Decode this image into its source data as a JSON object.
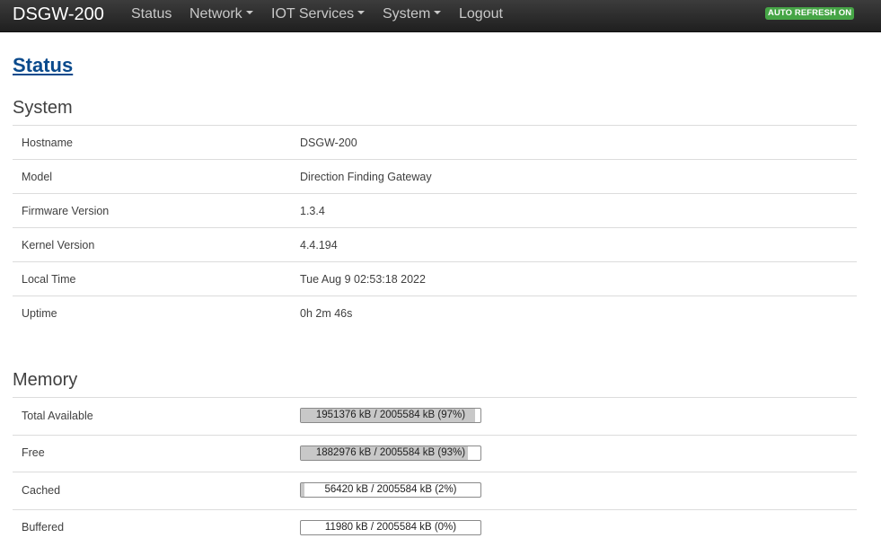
{
  "header": {
    "brand": "DSGW-200",
    "menu": [
      {
        "label": "Status",
        "dropdown": false
      },
      {
        "label": "Network",
        "dropdown": true
      },
      {
        "label": "IOT Services",
        "dropdown": true
      },
      {
        "label": "System",
        "dropdown": true
      },
      {
        "label": "Logout",
        "dropdown": false
      }
    ],
    "auto_refresh": "AUTO REFRESH ON"
  },
  "page_title": "Status",
  "system": {
    "title": "System",
    "rows": [
      {
        "key": "Hostname",
        "value": "DSGW-200"
      },
      {
        "key": "Model",
        "value": "Direction Finding Gateway"
      },
      {
        "key": "Firmware Version",
        "value": "1.3.4"
      },
      {
        "key": "Kernel Version",
        "value": "4.4.194"
      },
      {
        "key": "Local Time",
        "value": "Tue Aug 9 02:53:18 2022"
      },
      {
        "key": "Uptime",
        "value": "0h 2m 46s"
      }
    ]
  },
  "memory": {
    "title": "Memory",
    "rows": [
      {
        "key": "Total Available",
        "text": "1951376 kB / 2005584 kB (97%)",
        "fraction": 0.97
      },
      {
        "key": "Free",
        "text": "1882976 kB / 2005584 kB (93%)",
        "fraction": 0.93
      },
      {
        "key": "Cached",
        "text": "56420 kB / 2005584 kB (2%)",
        "fraction": 0.02
      },
      {
        "key": "Buffered",
        "text": "11980 kB / 2005584 kB (0%)",
        "fraction": 0.0
      }
    ]
  }
}
